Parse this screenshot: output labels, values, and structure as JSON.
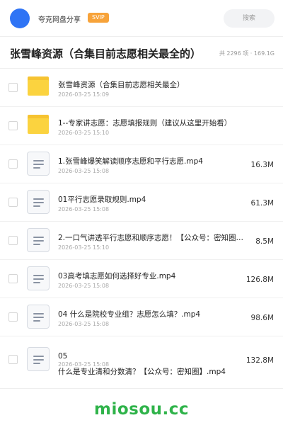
{
  "header": {
    "app_name": "夸克网盘分享",
    "badge": "SVIP",
    "search_label": "搜索"
  },
  "folder": {
    "title": "张雪峰资源（合集目前志愿相关最全的）",
    "meta": "共 2296 项 · 169.1G"
  },
  "files": [
    {
      "type": "folder",
      "name": "张雪峰资源（合集目前志愿相关最全）",
      "date": "2026-03-25 15:09",
      "size": ""
    },
    {
      "type": "folder",
      "name": "1--专家讲志愿：志愿填报规则（建议从这里开始看）",
      "date": "2026-03-25 15:10",
      "size": ""
    },
    {
      "type": "file",
      "name": "1.张雪峰爆笑解读顺序志愿和平行志愿.mp4",
      "date": "2026-03-25 15:08",
      "size": "16.3M"
    },
    {
      "type": "file",
      "name": "01平行志愿录取规则.mp4",
      "date": "2026-03-25 15:08",
      "size": "61.3M"
    },
    {
      "type": "file",
      "name": "2.一口气讲透平行志愿和顺序志愿！【公众号：密知圈】.mp4",
      "date": "2026-03-25 15:10",
      "size": "8.5M"
    },
    {
      "type": "file",
      "name": "03高考填志愿如何选择好专业.mp4",
      "date": "2026-03-25 15:08",
      "size": "126.8M"
    },
    {
      "type": "file",
      "name": "04 什么是院校专业组？志愿怎么填？.mp4",
      "date": "2026-03-25 15:08",
      "size": "98.6M"
    }
  ],
  "last_file": {
    "name_line1": "05",
    "name_line2": "什么是专业清和分数清？【公众号：密知圈】.mp4",
    "date": "2026-03-25 15:08",
    "size": "132.8M"
  },
  "footer": {
    "watermark": "miosou.cc"
  },
  "colors": {
    "accent": "#2f74f5",
    "svip": "#f7a33a",
    "folder": "#fbd33f",
    "watermark": "#2fb34a"
  }
}
